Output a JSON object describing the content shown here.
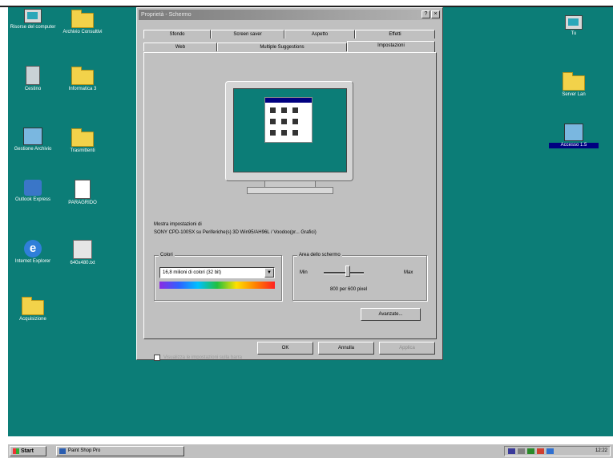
{
  "desktop": {
    "icons_left": [
      {
        "label": "Risorse del computer",
        "icon": "computer-icon"
      },
      {
        "label": "Archivio Consultivi",
        "icon": "folder-icon"
      },
      {
        "label": "Cestino",
        "icon": "recycle-bin-icon"
      },
      {
        "label": "Informatica 3",
        "icon": "folder-icon"
      },
      {
        "label": "Gestione Archivio",
        "icon": "network-icon"
      },
      {
        "label": "Trasmittenti",
        "icon": "folder-icon"
      },
      {
        "label": "Outlook Express",
        "icon": "outlook-express-icon"
      },
      {
        "label": "PARAGRIDO",
        "icon": "document-icon"
      },
      {
        "label": "Internet Explorer",
        "icon": "internet-explorer-icon"
      },
      {
        "label": "640x480.txt",
        "icon": "tool-icon"
      },
      {
        "label": "Acquisizione",
        "icon": "folder-icon"
      }
    ],
    "icons_right": [
      {
        "label": "Tu",
        "icon": "computer-icon"
      },
      {
        "label": "Server Lan",
        "icon": "folder-icon"
      },
      {
        "label": "Accesso 1.5",
        "icon": "network-icon"
      }
    ]
  },
  "dialog": {
    "title": "Proprietà - Schermo",
    "tabs_row1": [
      "Sfondo",
      "Screen saver",
      "Aspetto",
      "Effetti"
    ],
    "tabs_row2": [
      "Web",
      "Multiple Suggestions",
      "Impostazioni"
    ],
    "active_tab": "Impostazioni",
    "display_label": "Mostra impostazioni di",
    "display_value": "SONY CPD-100SX su Periferiche(s) 3D Win95/AH96L / Voodoo(pr... Grafici)",
    "colors": {
      "caption": "Colori",
      "selected": "16,8 milioni di colori (32 bit)"
    },
    "screen_area": {
      "caption": "Area dello schermo",
      "min": "Min",
      "max": "Max",
      "resolution": "800 per 600 pixel",
      "value_fraction": 0.6
    },
    "checkbox_label": "Visualizza le impostazioni sulla barra",
    "advanced_button": "Avanzate...",
    "ok_button": "OK",
    "cancel_button": "Annulla",
    "apply_button": "Applica"
  },
  "taskbar": {
    "start_label": "Start",
    "task_label": "Paint Shop Pro",
    "clock": "12:22"
  },
  "colors": {
    "desktop": "#0c7d77",
    "face": "#c0c0c0",
    "title_inactive": "#8a8a8a",
    "select_blue": "#000080"
  }
}
